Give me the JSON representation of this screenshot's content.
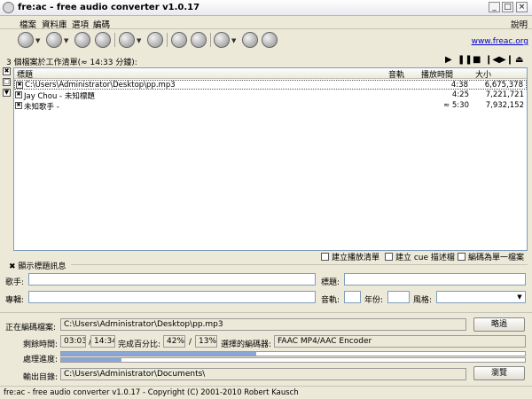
{
  "window": {
    "title": "fre:ac - free audio converter v1.0.17",
    "minimize": "_",
    "maximize": "□",
    "close": "×"
  },
  "menu": {
    "items": [
      "檔案",
      "資料庫",
      "選項",
      "編碼"
    ],
    "help": "說明"
  },
  "toolbar": {
    "site_link": "www.freac.org",
    "icons": [
      "add-files-icon",
      "add-folder-icon",
      "cdda-icon",
      "cd-info-icon",
      "search-icon",
      "cddb-icon",
      "tools-icon",
      "settings-icon",
      "play-icon",
      "pause-icon",
      "stop-icon"
    ]
  },
  "joblist": {
    "title": "3 個檔案於工作清單(≈ 14:33 分鐘):",
    "transport": [
      "▶",
      "❚❚",
      "■",
      "❙◀",
      "▶❙",
      "⏏"
    ],
    "side_controls": [
      "✖",
      "□",
      "▼"
    ],
    "columns": [
      "標題",
      "音軌",
      "播放時間",
      "大小"
    ],
    "rows": [
      {
        "check": "✖",
        "title": "C:\\Users\\Administrator\\Desktop\\pp.mp3",
        "track": "",
        "length": "4:38",
        "size": "6,675,378"
      },
      {
        "check": "✖",
        "title": "Jay Chou - 未知標題",
        "track": "",
        "length": "4:25",
        "size": "7,221,721"
      },
      {
        "check": "✖",
        "title": "未知歌手 -",
        "track": "",
        "length": "≈ 5:30",
        "size": "7,932,152"
      }
    ]
  },
  "options": {
    "playlist": "建立播放清單",
    "cue": "建立 cue 描述檔",
    "single": "編碼為單一檔案"
  },
  "tags": {
    "toggle": "✖",
    "title": "顯示標題訊息",
    "artist_label": "歌手:",
    "artist_value": "",
    "title_label": "標題:",
    "title_value": "",
    "album_label": "專輯:",
    "album_value": "",
    "track_label": "音軌:",
    "track_value": "",
    "year_label": "年份:",
    "year_value": "",
    "genre_label": "風格:",
    "genre_value": "",
    "genre_arrow": "▼"
  },
  "status": {
    "encoding_label": "正在編碼檔案:",
    "encoding_file": "C:\\Users\\Administrator\\Desktop\\pp.mp3",
    "skip_button": "略過",
    "time_label": "剩餘時間:",
    "time_left": "03:03",
    "slash": "/",
    "time_total": "14:34",
    "percent_label": "完成百分比:",
    "percent_file": "42%",
    "percent_total": "13%",
    "encoder_label": "選擇的編碼器:",
    "encoder_value": "FAAC MP4/AAC Encoder",
    "progress_label": "處理進度:",
    "progress_file": 0.42,
    "progress_total": 0.13,
    "output_label": "輸出目錄:",
    "output_value": "C:\\Users\\Administrator\\Documents\\",
    "browse_button": "瀏覽"
  },
  "statusbar": {
    "text": "fre:ac - free audio converter v1.0.17 - Copyright (C) 2001-2010 Robert Kausch"
  },
  "colors": {
    "progress": "#8aa6d8",
    "link": "#0000cc",
    "field_border": "#7f9db9"
  }
}
